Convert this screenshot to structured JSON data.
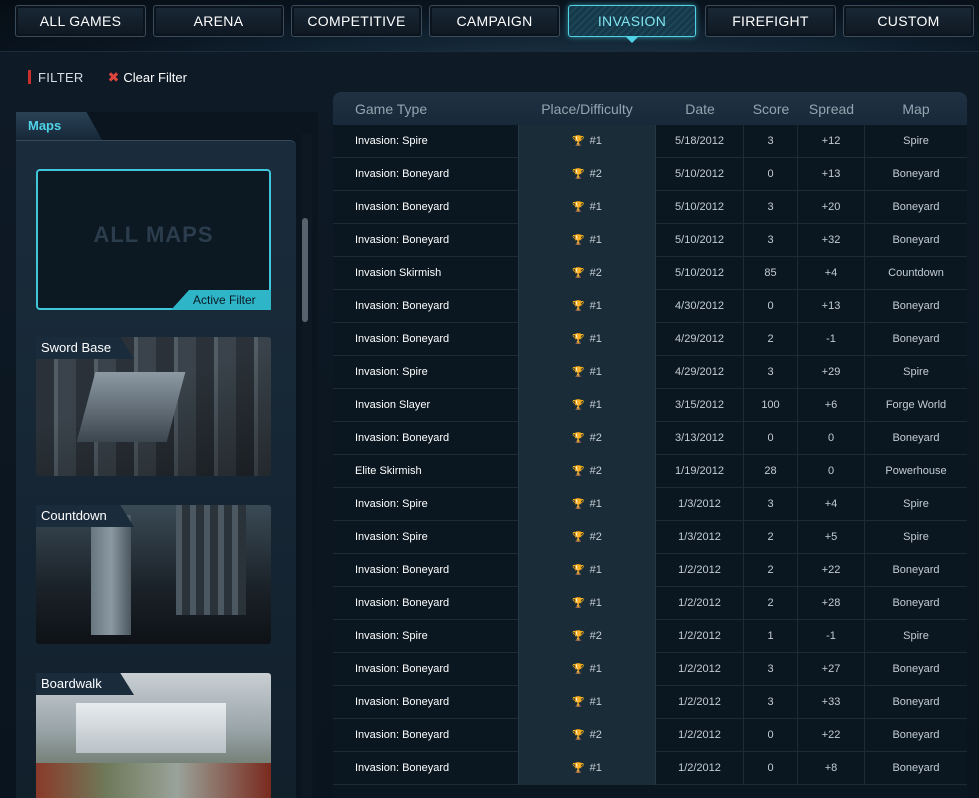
{
  "nav": {
    "tabs": [
      {
        "label": "ALL GAMES"
      },
      {
        "label": "ARENA"
      },
      {
        "label": "COMPETITIVE"
      },
      {
        "label": "CAMPAIGN"
      },
      {
        "label": "INVASION",
        "active": true
      },
      {
        "label": "FIREFIGHT"
      },
      {
        "label": "CUSTOM"
      }
    ]
  },
  "filter": {
    "label": "FILTER",
    "clear_label": "Clear Filter",
    "clear_icon": "x-icon"
  },
  "maps_panel": {
    "tab_label": "Maps",
    "all_maps_label": "ALL MAPS",
    "active_filter_label": "Active Filter",
    "maps": [
      {
        "name": "Sword Base"
      },
      {
        "name": "Countdown"
      },
      {
        "name": "Boardwalk"
      }
    ]
  },
  "table": {
    "headers": [
      "Game Type",
      "Place/Difficulty",
      "Date",
      "Score",
      "Spread",
      "Map"
    ],
    "rows": [
      {
        "type": "Invasion: Spire",
        "place": "#1",
        "date": "5/18/2012",
        "score": "3",
        "spread": "+12",
        "map": "Spire"
      },
      {
        "type": "Invasion: Boneyard",
        "place": "#2",
        "date": "5/10/2012",
        "score": "0",
        "spread": "+13",
        "map": "Boneyard"
      },
      {
        "type": "Invasion: Boneyard",
        "place": "#1",
        "date": "5/10/2012",
        "score": "3",
        "spread": "+20",
        "map": "Boneyard"
      },
      {
        "type": "Invasion: Boneyard",
        "place": "#1",
        "date": "5/10/2012",
        "score": "3",
        "spread": "+32",
        "map": "Boneyard"
      },
      {
        "type": "Invasion Skirmish",
        "place": "#2",
        "date": "5/10/2012",
        "score": "85",
        "spread": "+4",
        "map": "Countdown"
      },
      {
        "type": "Invasion: Boneyard",
        "place": "#1",
        "date": "4/30/2012",
        "score": "0",
        "spread": "+13",
        "map": "Boneyard"
      },
      {
        "type": "Invasion: Boneyard",
        "place": "#1",
        "date": "4/29/2012",
        "score": "2",
        "spread": "-1",
        "map": "Boneyard"
      },
      {
        "type": "Invasion: Spire",
        "place": "#1",
        "date": "4/29/2012",
        "score": "3",
        "spread": "+29",
        "map": "Spire"
      },
      {
        "type": "Invasion Slayer",
        "place": "#1",
        "date": "3/15/2012",
        "score": "100",
        "spread": "+6",
        "map": "Forge World"
      },
      {
        "type": "Invasion: Boneyard",
        "place": "#2",
        "date": "3/13/2012",
        "score": "0",
        "spread": "0",
        "map": "Boneyard"
      },
      {
        "type": "Elite Skirmish",
        "place": "#2",
        "date": "1/19/2012",
        "score": "28",
        "spread": "0",
        "map": "Powerhouse"
      },
      {
        "type": "Invasion: Spire",
        "place": "#1",
        "date": "1/3/2012",
        "score": "3",
        "spread": "+4",
        "map": "Spire"
      },
      {
        "type": "Invasion: Spire",
        "place": "#2",
        "date": "1/3/2012",
        "score": "2",
        "spread": "+5",
        "map": "Spire"
      },
      {
        "type": "Invasion: Boneyard",
        "place": "#1",
        "date": "1/2/2012",
        "score": "2",
        "spread": "+22",
        "map": "Boneyard"
      },
      {
        "type": "Invasion: Boneyard",
        "place": "#1",
        "date": "1/2/2012",
        "score": "2",
        "spread": "+28",
        "map": "Boneyard"
      },
      {
        "type": "Invasion: Spire",
        "place": "#2",
        "date": "1/2/2012",
        "score": "1",
        "spread": "-1",
        "map": "Spire"
      },
      {
        "type": "Invasion: Boneyard",
        "place": "#1",
        "date": "1/2/2012",
        "score": "3",
        "spread": "+27",
        "map": "Boneyard"
      },
      {
        "type": "Invasion: Boneyard",
        "place": "#1",
        "date": "1/2/2012",
        "score": "3",
        "spread": "+33",
        "map": "Boneyard"
      },
      {
        "type": "Invasion: Boneyard",
        "place": "#2",
        "date": "1/2/2012",
        "score": "0",
        "spread": "+22",
        "map": "Boneyard"
      },
      {
        "type": "Invasion: Boneyard",
        "place": "#1",
        "date": "1/2/2012",
        "score": "0",
        "spread": "+8",
        "map": "Boneyard"
      }
    ]
  },
  "colors": {
    "accent": "#4fd3e6",
    "background": "#08121c",
    "filter_mark": "#c9302c"
  }
}
